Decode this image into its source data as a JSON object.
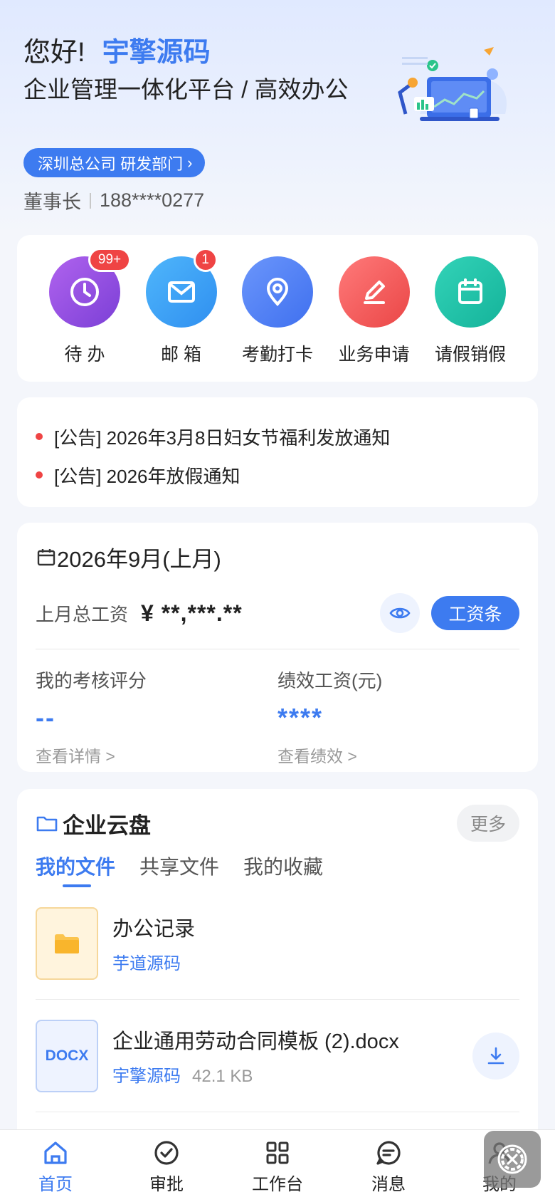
{
  "header": {
    "greeting": "您好!",
    "user_name": "宇擎源码",
    "slogan": "企业管理一体化平台 / 高效办公",
    "dept": "深圳总公司 研发部门",
    "role": "董事长",
    "phone": "188****0277"
  },
  "quick_actions": [
    {
      "label": "待 办",
      "icon": "clock-icon",
      "badge": "99+",
      "color": "#8b4fe0"
    },
    {
      "label": "邮 箱",
      "icon": "mail-icon",
      "badge": "1",
      "color": "#3aa0f5"
    },
    {
      "label": "考勤打卡",
      "icon": "location-icon",
      "badge": "",
      "color": "#4a7cf5"
    },
    {
      "label": "业务申请",
      "icon": "pen-icon",
      "badge": "",
      "color": "#f25a5a"
    },
    {
      "label": "请假销假",
      "icon": "calendar-icon",
      "badge": "",
      "color": "#1fc2a8"
    }
  ],
  "notices": [
    "[公告] 2026年3月8日妇女节福利发放通知",
    "[公告] 2026年放假通知"
  ],
  "salary": {
    "period": "2026年9月(上月)",
    "total_label": "上月总工资",
    "total_value": "¥ **,***.**",
    "payslip_button": "工资条",
    "rating_label": "我的考核评分",
    "rating_value": "--",
    "rating_link": "查看详情 >",
    "perf_label": "绩效工资(元)",
    "perf_value": "****",
    "perf_link": "查看绩效 >"
  },
  "cloud": {
    "title": "企业云盘",
    "more": "更多",
    "tabs": [
      "我的文件",
      "共享文件",
      "我的收藏"
    ],
    "files": [
      {
        "name": "办公记录",
        "owner": "芋道源码",
        "size": "",
        "type": "folder"
      },
      {
        "name": "企业通用劳动合同模板 (2).docx",
        "owner": "宇擎源码",
        "size": "42.1 KB",
        "type": "DOCX"
      }
    ]
  },
  "tabbar": [
    {
      "label": "首页",
      "icon": "home-icon",
      "active": true
    },
    {
      "label": "审批",
      "icon": "check-circle-icon",
      "active": false
    },
    {
      "label": "工作台",
      "icon": "grid-icon",
      "active": false
    },
    {
      "label": "消息",
      "icon": "chat-icon",
      "active": false
    },
    {
      "label": "我的",
      "icon": "user-icon",
      "active": false
    }
  ],
  "colors": {
    "accent": "#3d7bf0",
    "badge": "#ef4444"
  }
}
